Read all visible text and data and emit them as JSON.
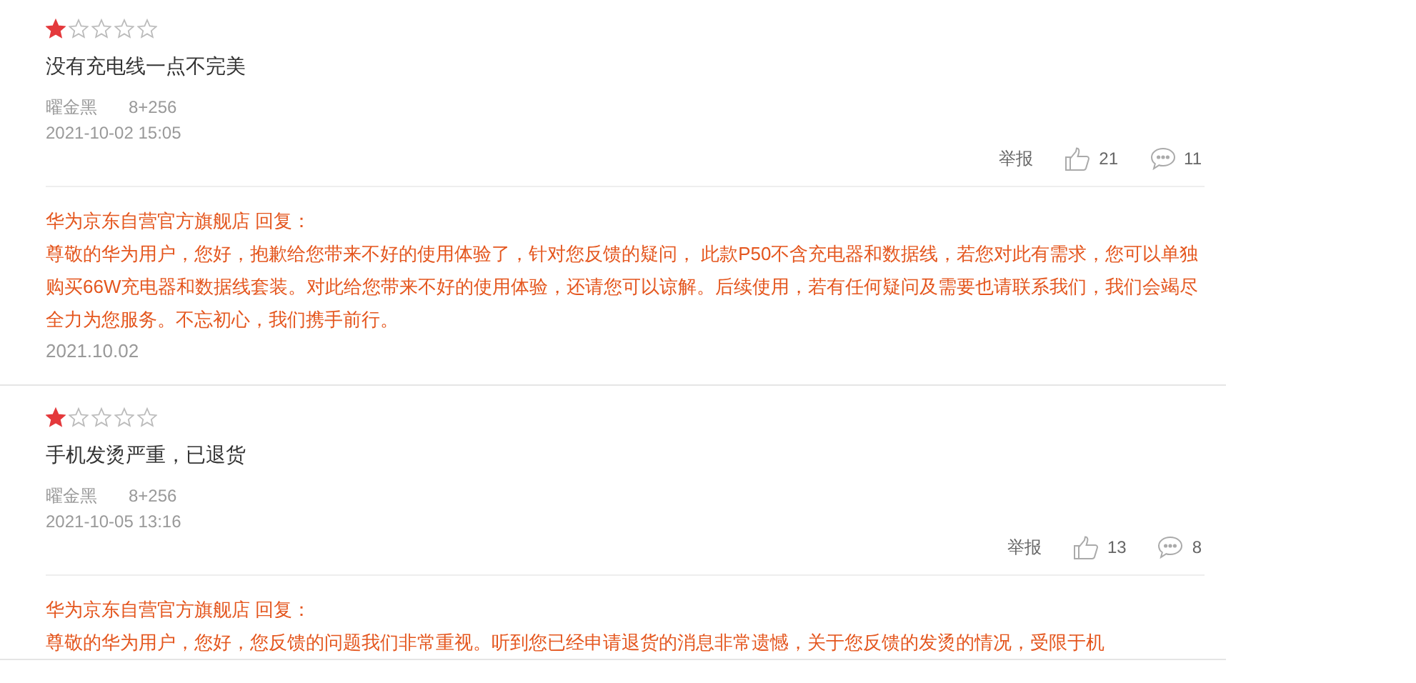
{
  "reviews": [
    {
      "stars": 1,
      "comment": "没有充电线一点不完美",
      "color_name": "曜金黑",
      "spec": "8+256",
      "time": "2021-10-02 15:05",
      "report": "举报",
      "likes": "21",
      "replies": "11",
      "reply": {
        "shop": "华为京东自营官方旗舰店 回复：",
        "text": "尊敬的华为用户，您好，抱歉给您带来不好的使用体验了，针对您反馈的疑问， 此款P50不含充电器和数据线，若您对此有需求，您可以单独购买66W充电器和数据线套装。对此给您带来不好的使用体验，还请您可以谅解。后续使用，若有任何疑问及需要也请联系我们，我们会竭尽全力为您服务。不忘初心，我们携手前行。",
        "date": "2021.10.02"
      }
    },
    {
      "stars": 1,
      "comment": "手机发烫严重，已退货",
      "color_name": "曜金黑",
      "spec": "8+256",
      "time": "2021-10-05 13:16",
      "report": "举报",
      "likes": "13",
      "replies": "8",
      "reply": {
        "shop": "华为京东自营官方旗舰店 回复：",
        "text": "尊敬的华为用户，您好，您反馈的问题我们非常重视。听到您已经申请退货的消息非常遗憾，关于您反馈的发烫的情况，受限于机"
      }
    }
  ]
}
